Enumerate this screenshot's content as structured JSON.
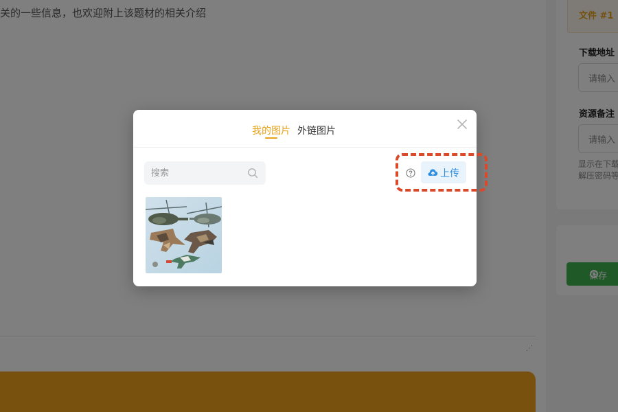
{
  "background": {
    "intro_text": "关的一些信息，也欢迎附上该题材的相关介绍",
    "resize_glyph": "⋰",
    "file_tab_label": "文件 #1",
    "download_label": "下载地址",
    "download_placeholder": "请输入",
    "note_label": "资源备注",
    "note_placeholder": "请输入",
    "help_line_1": "显示在下载",
    "help_line_2": "解压密码等",
    "save_label": "保存",
    "accent_color": "#e8a21a",
    "save_color": "#3fb24f"
  },
  "modal": {
    "tabs": [
      {
        "label": "我的图片",
        "active": true
      },
      {
        "label": "外链图片",
        "active": false
      }
    ],
    "search": {
      "placeholder": "搜索",
      "value": ""
    },
    "upload_label": "上传",
    "icons": {
      "close": "close-icon",
      "search": "search-icon",
      "help": "help-icon",
      "upload": "cloud-upload-icon"
    },
    "images": [
      {
        "description_name": "model-aircraft-photo"
      }
    ],
    "highlight_color": "#d94a2b",
    "upload_color": "#2f8ee0"
  }
}
